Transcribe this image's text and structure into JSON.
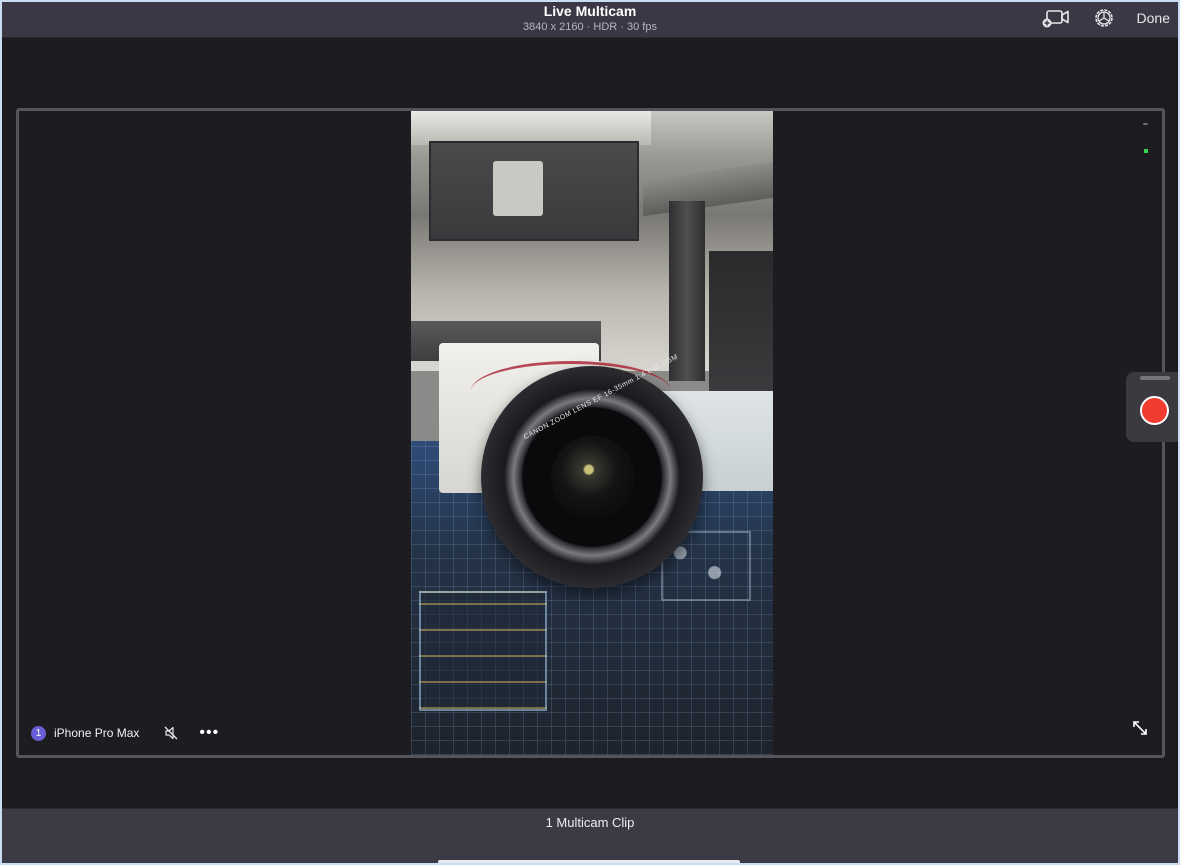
{
  "header": {
    "title": "Live Multicam",
    "subtitle": "3840 x 2160 · HDR · 30 fps",
    "add_camera_icon": "video-camera-plus-icon",
    "settings_icon": "gear-icon",
    "done_label": "Done"
  },
  "camera": {
    "index": "1",
    "name": "iPhone Pro Max",
    "mute_icon": "speaker-muted-icon",
    "more_label": "•••",
    "expand_icon": "expand-arrows-icon",
    "feed_lens_text": "CANON ZOOM LENS EF 16-35mm 1:4 L IS USM",
    "accent_color": "#6a5fd6"
  },
  "indicators": {
    "status_color": "#39d353"
  },
  "record": {
    "label": "Record",
    "color": "#f23c30"
  },
  "footer": {
    "clip_count": "1 Multicam Clip"
  }
}
